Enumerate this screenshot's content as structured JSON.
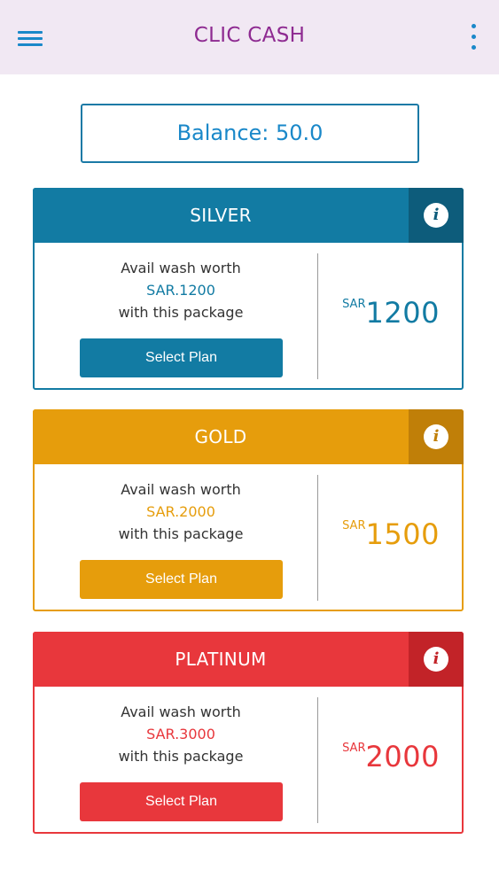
{
  "header": {
    "title": "CLIC CASH",
    "menu_icon": "hamburger-menu-icon",
    "more_icon": "vertical-dots-icon",
    "background": "#f1e8f3",
    "title_color": "#8e2a91",
    "icon_color": "#1a88c9"
  },
  "balance": {
    "text": "Balance: 50.0"
  },
  "plans": [
    {
      "name": "SILVER",
      "color": "#127ba3",
      "info_bg": "#0d5c7b",
      "line1": "Avail wash worth",
      "worth": "SAR.1200",
      "line3": "with this package",
      "button": "Select Plan",
      "currency": "SAR",
      "price": "1200"
    },
    {
      "name": "GOLD",
      "color": "#e69d0c",
      "info_bg": "#c07f08",
      "line1": "Avail wash worth",
      "worth": "SAR.2000",
      "line3": "with this package",
      "button": "Select Plan",
      "currency": "SAR",
      "price": "1500"
    },
    {
      "name": "PLATINUM",
      "color": "#e8373c",
      "info_bg": "#c22328",
      "line1": "Avail wash worth",
      "worth": "SAR.3000",
      "line3": "with this package",
      "button": "Select Plan",
      "currency": "SAR",
      "price": "2000"
    }
  ]
}
